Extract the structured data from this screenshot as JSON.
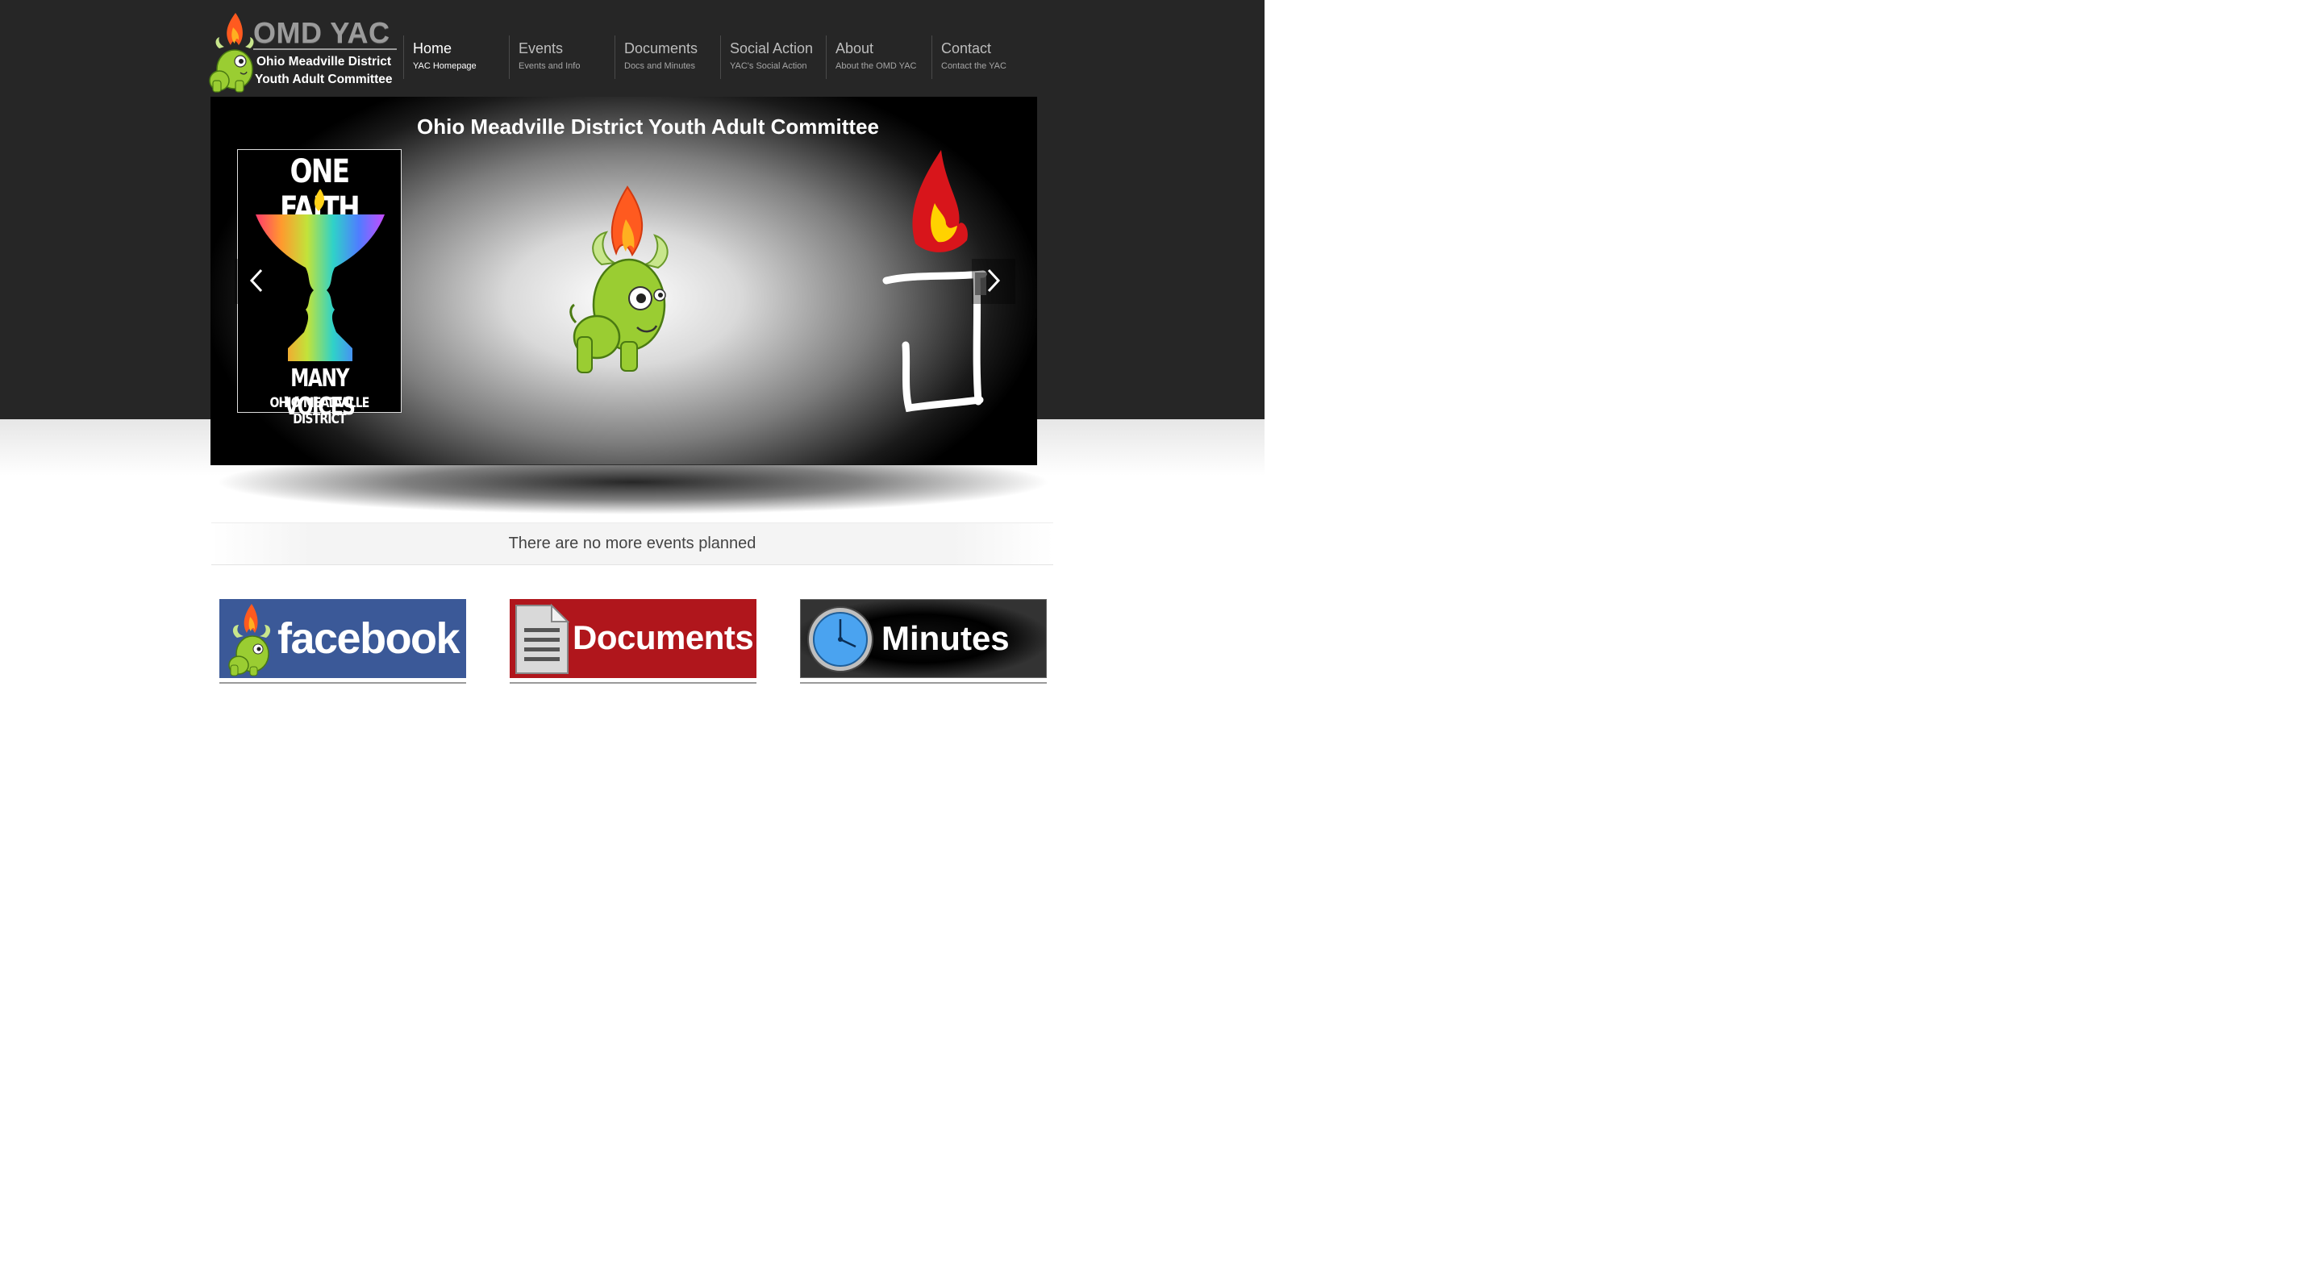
{
  "header": {
    "logo_title": "OMD YAC",
    "logo_line1": "Ohio Meadville District",
    "logo_line2": "Youth Adult Committee"
  },
  "nav": {
    "items": [
      {
        "title": "Home",
        "subtitle": "YAC Homepage"
      },
      {
        "title": "Events",
        "subtitle": "Events and Info"
      },
      {
        "title": "Documents",
        "subtitle": "Docs and Minutes"
      },
      {
        "title": "Social Action",
        "subtitle": "YAC's Social Action"
      },
      {
        "title": "About",
        "subtitle": "About the OMD YAC"
      },
      {
        "title": "Contact",
        "subtitle": "Contact the YAC"
      }
    ],
    "active": "Home"
  },
  "slider": {
    "title": "Ohio Meadville District Youth Adult Committee",
    "poster_top": "ONE FAITH",
    "poster_middle": "MANY VOICES",
    "poster_bottom": "OHIO MEADVILLE DISTRICT",
    "prev_icon": "chevron-left-icon",
    "next_icon": "chevron-right-icon"
  },
  "events": {
    "message": "There are no more events planned"
  },
  "tiles": [
    {
      "label": "facebook",
      "icon": "mascot-icon",
      "color": "#3b5998"
    },
    {
      "label": "Documents",
      "icon": "document-icon",
      "color": "#b0161c"
    },
    {
      "label": "Minutes",
      "icon": "clock-icon",
      "color": "#000000"
    }
  ],
  "colors": {
    "header_bg": "#262626",
    "mascot_green": "#9acd32",
    "flame": "#ff5a1f"
  }
}
